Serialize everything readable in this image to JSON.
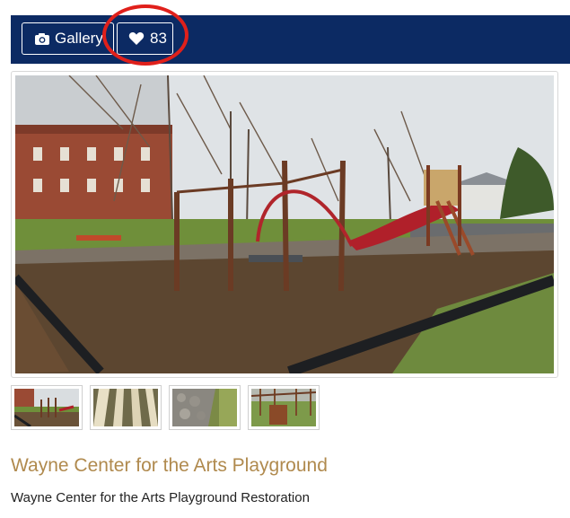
{
  "toolbar": {
    "gallery_label": "Gallery",
    "likes_count": "83",
    "bar_color": "#0c2a63",
    "highlight_color": "#e0201b"
  },
  "icons": {
    "gallery": "camera-icon",
    "likes": "heart-icon"
  },
  "thumbnails": [
    {
      "subject": "playground-overview"
    },
    {
      "subject": "timber-beams"
    },
    {
      "subject": "stone-wall"
    },
    {
      "subject": "play-equipment"
    }
  ],
  "article": {
    "title": "Wayne Center for the Arts Playground",
    "subtitle": "Wayne Center for the Arts Playground Restoration",
    "title_color": "#b08a4e"
  }
}
